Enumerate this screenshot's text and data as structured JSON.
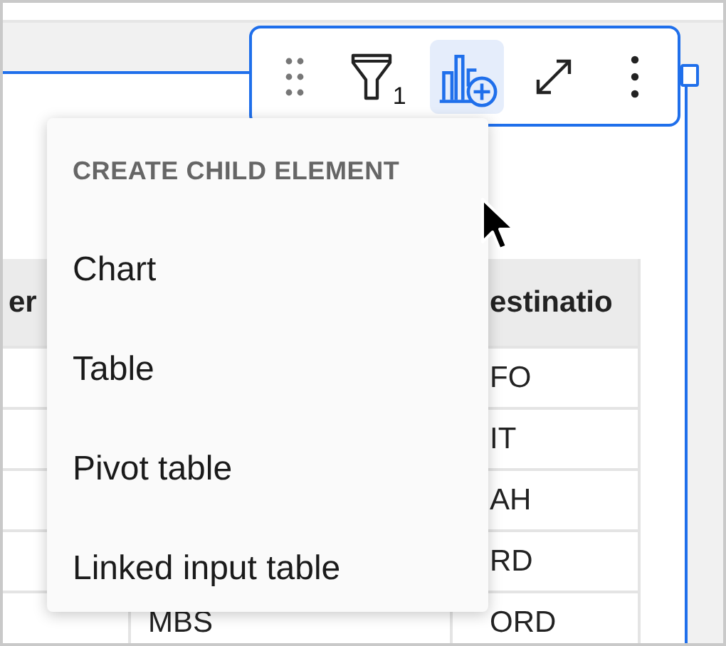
{
  "toolbar": {
    "items": [
      {
        "kind": "drag",
        "selected": false
      },
      {
        "kind": "filter",
        "badge": "1",
        "selected": false
      },
      {
        "kind": "child",
        "selected": true
      },
      {
        "kind": "expand",
        "selected": false
      },
      {
        "kind": "more",
        "selected": false
      }
    ]
  },
  "menu": {
    "heading": "CREATE CHILD ELEMENT",
    "items": [
      {
        "label": "Chart"
      },
      {
        "label": "Table"
      },
      {
        "label": "Pivot table"
      },
      {
        "label": "Linked input table"
      }
    ]
  },
  "table": {
    "columns": [
      {
        "label": "er"
      },
      {},
      {
        "label": "estinatio"
      }
    ],
    "rows": [
      {
        "column_3": "FO"
      },
      {
        "column_3": "IT"
      },
      {
        "column_3": "AH"
      },
      {
        "column_3": "RD"
      },
      {
        "column_2": "MBS",
        "column_3": "ORD"
      }
    ]
  }
}
